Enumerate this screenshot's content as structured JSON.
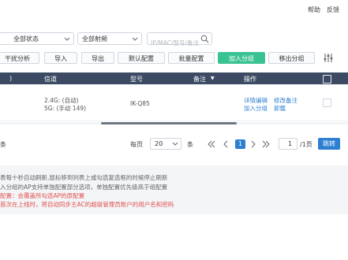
{
  "topbar": {
    "help": "帮助",
    "feedback": "反馈"
  },
  "filters": {
    "status": "全部状态",
    "band": "全部射频",
    "search_placeholder": "IP/MAC/型号/备注"
  },
  "toolbar": {
    "buttons": [
      "干扰分析",
      "导入",
      "导出",
      "默认配置",
      "批量配置",
      "加入分组",
      "移出分组"
    ]
  },
  "table": {
    "headers": {
      "partial": ")",
      "channel": "信道",
      "model": "型号",
      "remark": "备注",
      "remark_arrow": "▼",
      "action": "操作"
    },
    "rows": [
      {
        "channel_24": "2.4G: (自动)",
        "channel_5": "5G: (手动 149)",
        "model": "IK-Q85",
        "actions": [
          "详情编辑",
          "修改备注",
          "加入分组",
          "卸载"
        ]
      }
    ]
  },
  "pagination": {
    "total_suffix": "条",
    "per_page_label": "每页",
    "per_page_value": "20",
    "per_page_unit": "条",
    "current_page": "1",
    "page_input": "1",
    "page_total": "/1页",
    "jump": "跳转"
  },
  "notice": {
    "lines": [
      {
        "text": "表每十秒自动刷新,鼠标移到列表上或勾选复选框的时候停止刷新",
        "color": "#666666"
      },
      {
        "text": "入分组的AP支持单独配置部分选项，单独配置优先级高于组配置",
        "color": "#666666"
      },
      {
        "text": "配置：会覆盖所勾选AP的原配置",
        "color": "#e05050"
      },
      {
        "text": "首次在上线时，将自动同步主AC的超级管理员账户的用户名和密码",
        "color": "#e05050"
      }
    ]
  }
}
